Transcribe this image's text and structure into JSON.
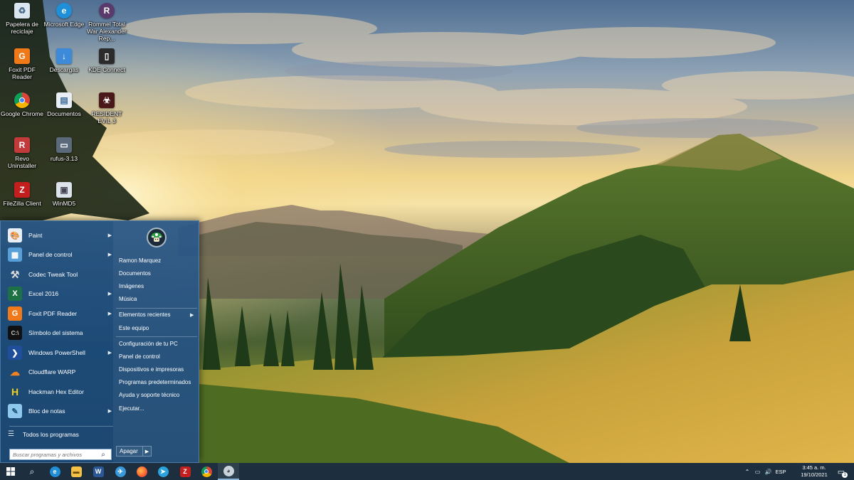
{
  "desktop": {
    "icons": [
      {
        "label": "Papelera de reciclaje",
        "icon": "recycle-bin-icon"
      },
      {
        "label": "Microsoft Edge",
        "icon": "edge-icon"
      },
      {
        "label": "Rommel Total War Alexander Rep...",
        "icon": "game-icon"
      },
      {
        "label": "Foxit PDF Reader",
        "icon": "foxit-icon"
      },
      {
        "label": "Descargas",
        "icon": "downloads-icon"
      },
      {
        "label": "KDE Connect",
        "icon": "kde-connect-icon"
      },
      {
        "label": "Google Chrome",
        "icon": "chrome-icon"
      },
      {
        "label": "Documentos",
        "icon": "documents-icon"
      },
      {
        "label": "RESIDENT EVIL 3",
        "icon": "resident-evil-icon"
      },
      {
        "label": "Revo Uninstaller",
        "icon": "revo-icon"
      },
      {
        "label": "rufus-3.13",
        "icon": "rufus-icon"
      },
      {
        "label": "FileZilla Client",
        "icon": "filezilla-icon"
      },
      {
        "label": "WinMD5",
        "icon": "winmd5-icon"
      }
    ]
  },
  "start_menu": {
    "programs": [
      {
        "label": "Paint",
        "icon": "paint-icon",
        "submenu": true
      },
      {
        "label": "Panel de control",
        "icon": "control-panel-icon",
        "submenu": true
      },
      {
        "label": "Codec Tweak Tool",
        "icon": "tools-icon",
        "submenu": false
      },
      {
        "label": "Excel 2016",
        "icon": "excel-icon",
        "submenu": true
      },
      {
        "label": "Foxit PDF Reader",
        "icon": "foxit-icon",
        "submenu": true
      },
      {
        "label": "Símbolo del sistema",
        "icon": "cmd-icon",
        "submenu": false
      },
      {
        "label": "Windows PowerShell",
        "icon": "powershell-icon",
        "submenu": true
      },
      {
        "label": "Cloudflare WARP",
        "icon": "cloudflare-icon",
        "submenu": false
      },
      {
        "label": "Hackman Hex Editor",
        "icon": "hex-editor-icon",
        "submenu": false
      },
      {
        "label": "Bloc de notas",
        "icon": "notepad-icon",
        "submenu": true
      }
    ],
    "all_programs_label": "Todos los programas",
    "search_placeholder": "Buscar programas y archivos",
    "right": {
      "user_name": "Ramon Marquez",
      "documents": "Documentos",
      "images": "Imágenes",
      "music": "Música",
      "recent_items": "Elementos recientes",
      "this_pc": "Este equipo",
      "pc_settings": "Configuración de tu PC",
      "control_panel": "Panel de control",
      "devices_printers": "Dispositivos e impresoras",
      "default_programs": "Programas predeterminados",
      "help_support": "Ayuda y soporte técnico",
      "run": "Ejecutar...",
      "shutdown": "Apagar"
    }
  },
  "taskbar": {
    "language": "ESP",
    "time": "3:45 a. m.",
    "date": "19/10/2021",
    "notification_count": "1"
  }
}
